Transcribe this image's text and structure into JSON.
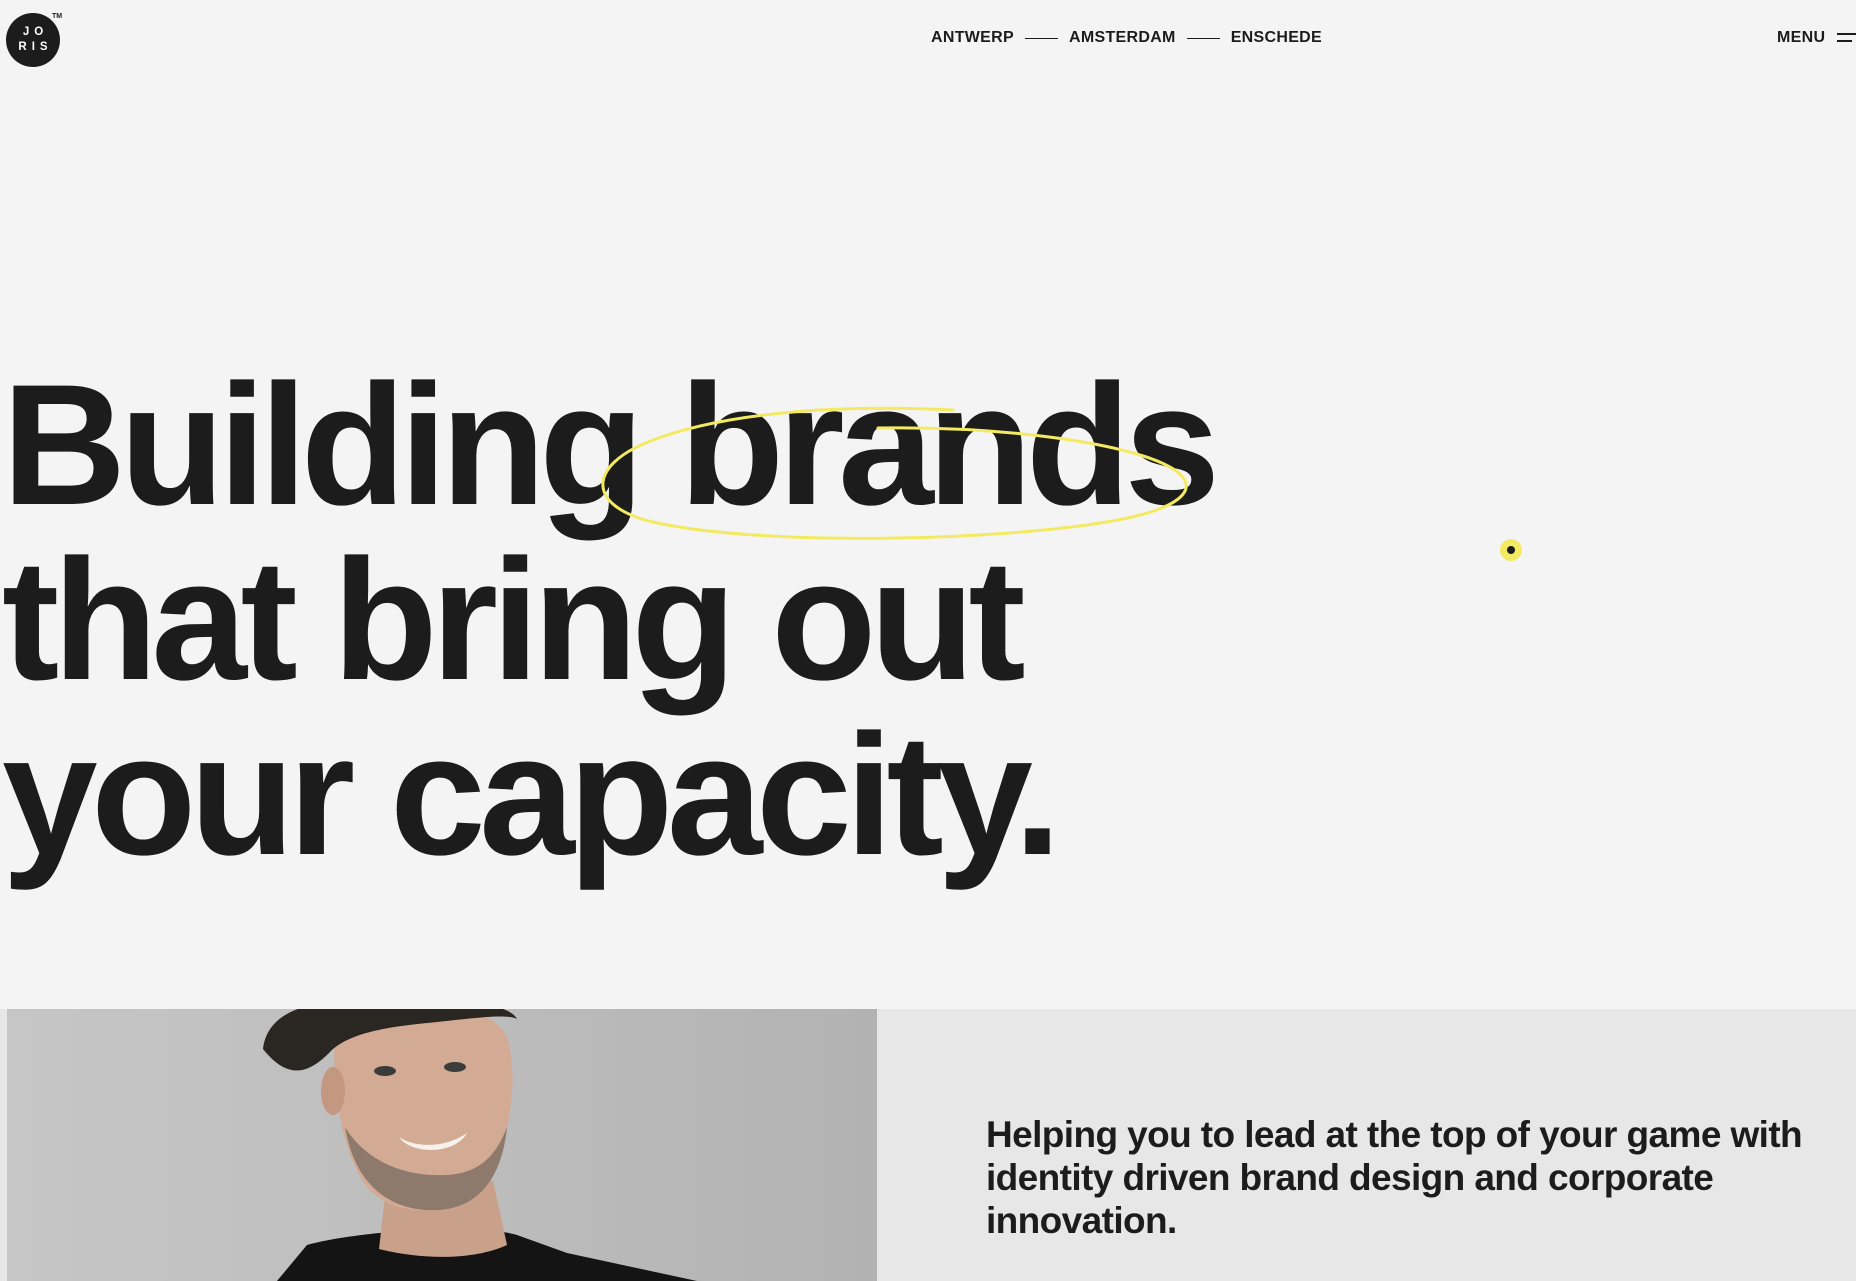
{
  "logo": {
    "line1": "JO",
    "line2": "RIS",
    "trademark": "TM"
  },
  "nav": {
    "locations": [
      "ANTWERP",
      "AMSTERDAM",
      "ENSCHEDE"
    ],
    "menu_label": "MENU",
    "menu_icon": "hamburger-icon"
  },
  "hero": {
    "line1_start": "Building",
    "line1_highlight": "brands",
    "line2": "that bring out",
    "line3": "your capacity."
  },
  "intro": {
    "text": "Helping you to lead at the top of your game with identity driven brand design and corporate innovation."
  },
  "colors": {
    "background": "#f4f4f4",
    "text": "#1c1c1c",
    "accent_yellow": "#f3ea62",
    "band": "#e7e7e7"
  }
}
